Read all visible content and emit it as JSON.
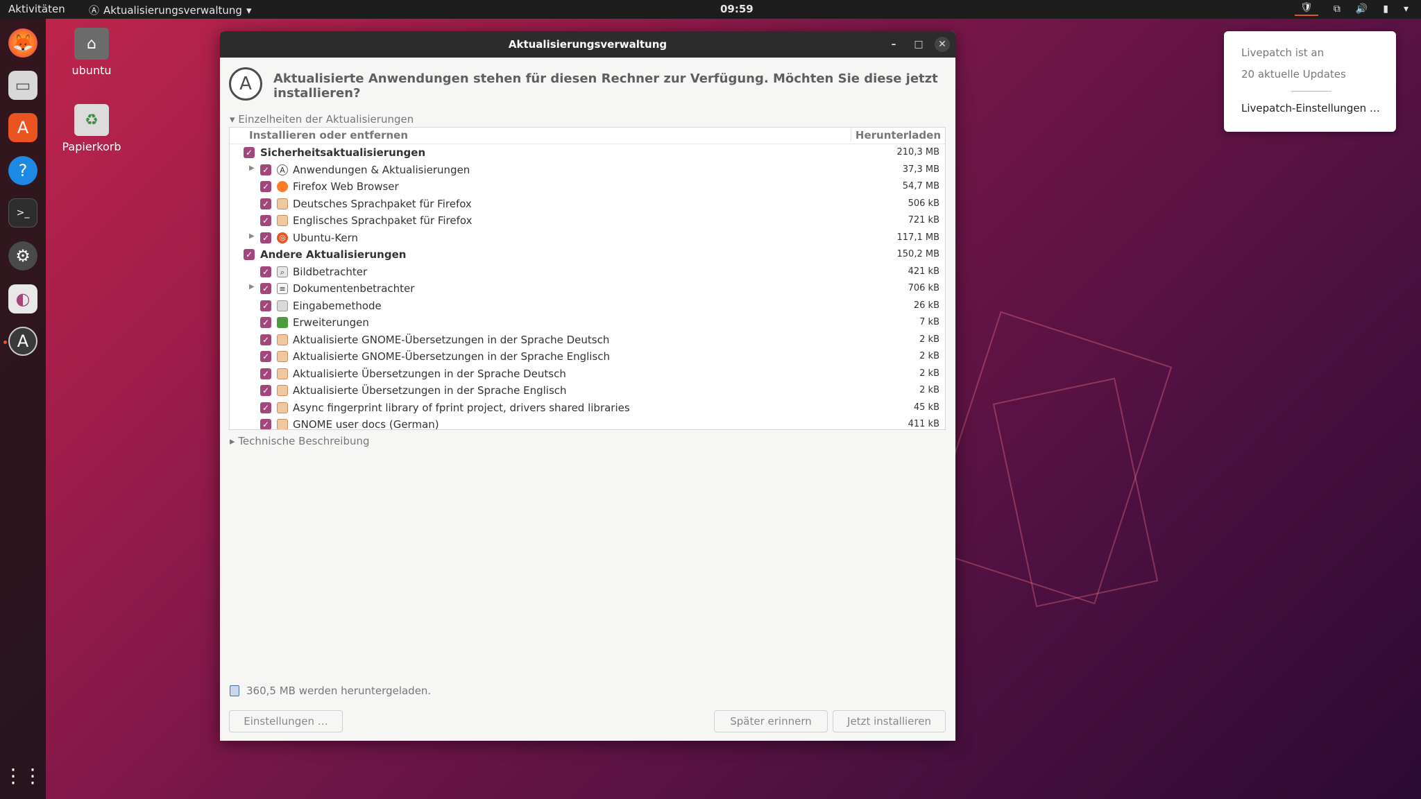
{
  "topbar": {
    "activities": "Aktivitäten",
    "app_menu": "Aktualisierungsverwaltung",
    "clock": "09:59"
  },
  "desktop": {
    "home_label": "ubuntu",
    "trash_label": "Papierkorb"
  },
  "popup": {
    "line1": "Livepatch ist an",
    "line2": "20 aktuelle Updates",
    "settings_link": "Livepatch-Einstellungen …"
  },
  "window": {
    "title": "Aktualisierungsverwaltung",
    "headline": "Aktualisierte Anwendungen stehen für diesen Rechner zur Verfügung. Möchten Sie diese jetzt installieren?",
    "details_toggle": "Einzelheiten der Aktualisierungen",
    "tech_toggle": "Technische Beschreibung",
    "columns": {
      "name": "Installieren oder entfernen",
      "download": "Herunterladen"
    },
    "rows": [
      {
        "label": "Sicherheitsaktualisierungen",
        "size": "210,3 MB"
      },
      {
        "label": "Anwendungen & Aktualisierungen",
        "size": "37,3 MB"
      },
      {
        "label": "Firefox Web Browser",
        "size": "54,7 MB"
      },
      {
        "label": "Deutsches Sprachpaket für Firefox",
        "size": "506 kB"
      },
      {
        "label": "Englisches Sprachpaket für Firefox",
        "size": "721 kB"
      },
      {
        "label": "Ubuntu-Kern",
        "size": "117,1 MB"
      },
      {
        "label": "Andere Aktualisierungen",
        "size": "150,2 MB"
      },
      {
        "label": "Bildbetrachter",
        "size": "421 kB"
      },
      {
        "label": "Dokumentenbetrachter",
        "size": "706 kB"
      },
      {
        "label": "Eingabemethode",
        "size": "26 kB"
      },
      {
        "label": "Erweiterungen",
        "size": "7 kB"
      },
      {
        "label": "Aktualisierte GNOME-Übersetzungen in der Sprache Deutsch",
        "size": "2 kB"
      },
      {
        "label": "Aktualisierte GNOME-Übersetzungen in der Sprache Englisch",
        "size": "2 kB"
      },
      {
        "label": "Aktualisierte Übersetzungen in der Sprache Deutsch",
        "size": "2 kB"
      },
      {
        "label": "Aktualisierte Übersetzungen in der Sprache Englisch",
        "size": "2 kB"
      },
      {
        "label": "Async fingerprint library of fprint project, drivers shared libraries",
        "size": "45 kB"
      },
      {
        "label": "GNOME user docs (German)",
        "size": "411 kB"
      }
    ],
    "summary": "360,5 MB werden heruntergeladen.",
    "buttons": {
      "settings": "Einstellungen …",
      "remind_later": "Später erinnern",
      "install_now": "Jetzt installieren"
    }
  },
  "colors": {
    "checkbox": "#a3467c",
    "accent": "#e95420"
  }
}
